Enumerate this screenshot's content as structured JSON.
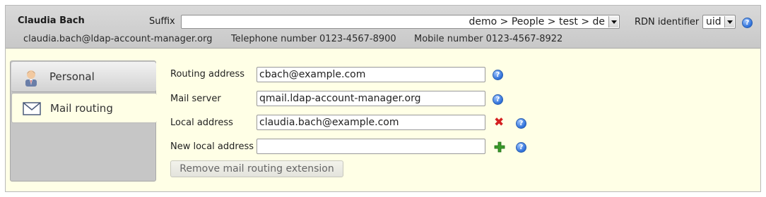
{
  "header": {
    "user_name": "Claudia Bach",
    "suffix_label": "Suffix",
    "suffix_value": "demo > People > test > de",
    "rdn_label": "RDN identifier",
    "rdn_value": "uid",
    "help_glyph": "?"
  },
  "info": {
    "email": "claudia.bach@ldap-account-manager.org",
    "telephone": "Telephone number 0123-4567-8900",
    "mobile": "Mobile number 0123-4567-8922"
  },
  "tabs": [
    {
      "label": "Personal",
      "icon": "user-icon",
      "active": false
    },
    {
      "label": "Mail routing",
      "icon": "envelope-icon",
      "active": true
    }
  ],
  "form": {
    "routing_address": {
      "label": "Routing address",
      "value": "cbach@example.com"
    },
    "mail_server": {
      "label": "Mail server",
      "value": "qmail.ldap-account-manager.org"
    },
    "local_address": {
      "label": "Local address",
      "value": "claudia.bach@example.com"
    },
    "new_local_address": {
      "label": "New local address",
      "value": ""
    },
    "remove_button": "Remove mail routing extension"
  },
  "colors": {
    "content_bg": "#ffffe6",
    "header_bg": "#c8c8c8",
    "help_blue": "#2d6fd8",
    "delete_red": "#d42020",
    "add_green": "#3a9a2a"
  }
}
